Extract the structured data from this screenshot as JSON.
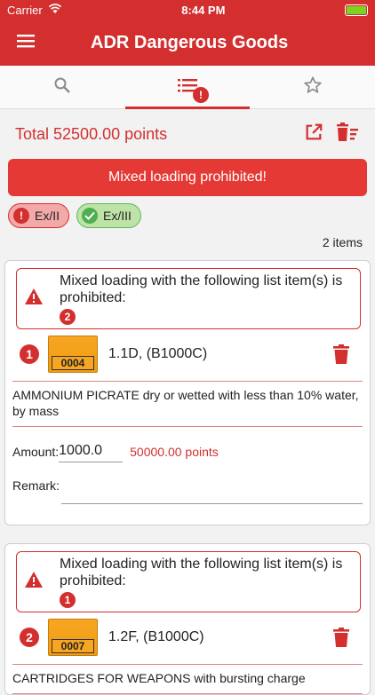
{
  "status": {
    "carrier": "Carrier",
    "time": "8:44 PM"
  },
  "app": {
    "title": "ADR Dangerous Goods"
  },
  "tabs": [
    {
      "name": "search",
      "icon": "search-icon"
    },
    {
      "name": "list",
      "icon": "list-icon",
      "badge": "!"
    },
    {
      "name": "favorites",
      "icon": "star-icon"
    }
  ],
  "summary": {
    "total": "Total 52500.00 points"
  },
  "banner": {
    "text": "Mixed loading prohibited!"
  },
  "chips": [
    {
      "label": "Ex/II"
    },
    {
      "label": "Ex/III"
    }
  ],
  "list": {
    "count": "2 items"
  },
  "items": [
    {
      "warning": "Mixed loading with the following list item(s) is prohibited:",
      "conflict": "2",
      "index": "1",
      "un": "0004",
      "classification": "1.1D, (B1000C)",
      "description": "AMMONIUM PICRATE dry or wetted with less than 10% water, by mass",
      "amount_label": "Amount:",
      "amount": "1000.0",
      "points": "50000.00 points",
      "remark_label": "Remark:"
    },
    {
      "warning": "Mixed loading with the following list item(s) is prohibited:",
      "conflict": "1",
      "index": "2",
      "un": "0007",
      "classification": "1.2F, (B1000C)",
      "description": "CARTRIDGES FOR WEAPONS with bursting charge"
    }
  ],
  "colors": {
    "primary": "#d32f2f",
    "banner": "#e53935",
    "plate": "#f6a623"
  }
}
